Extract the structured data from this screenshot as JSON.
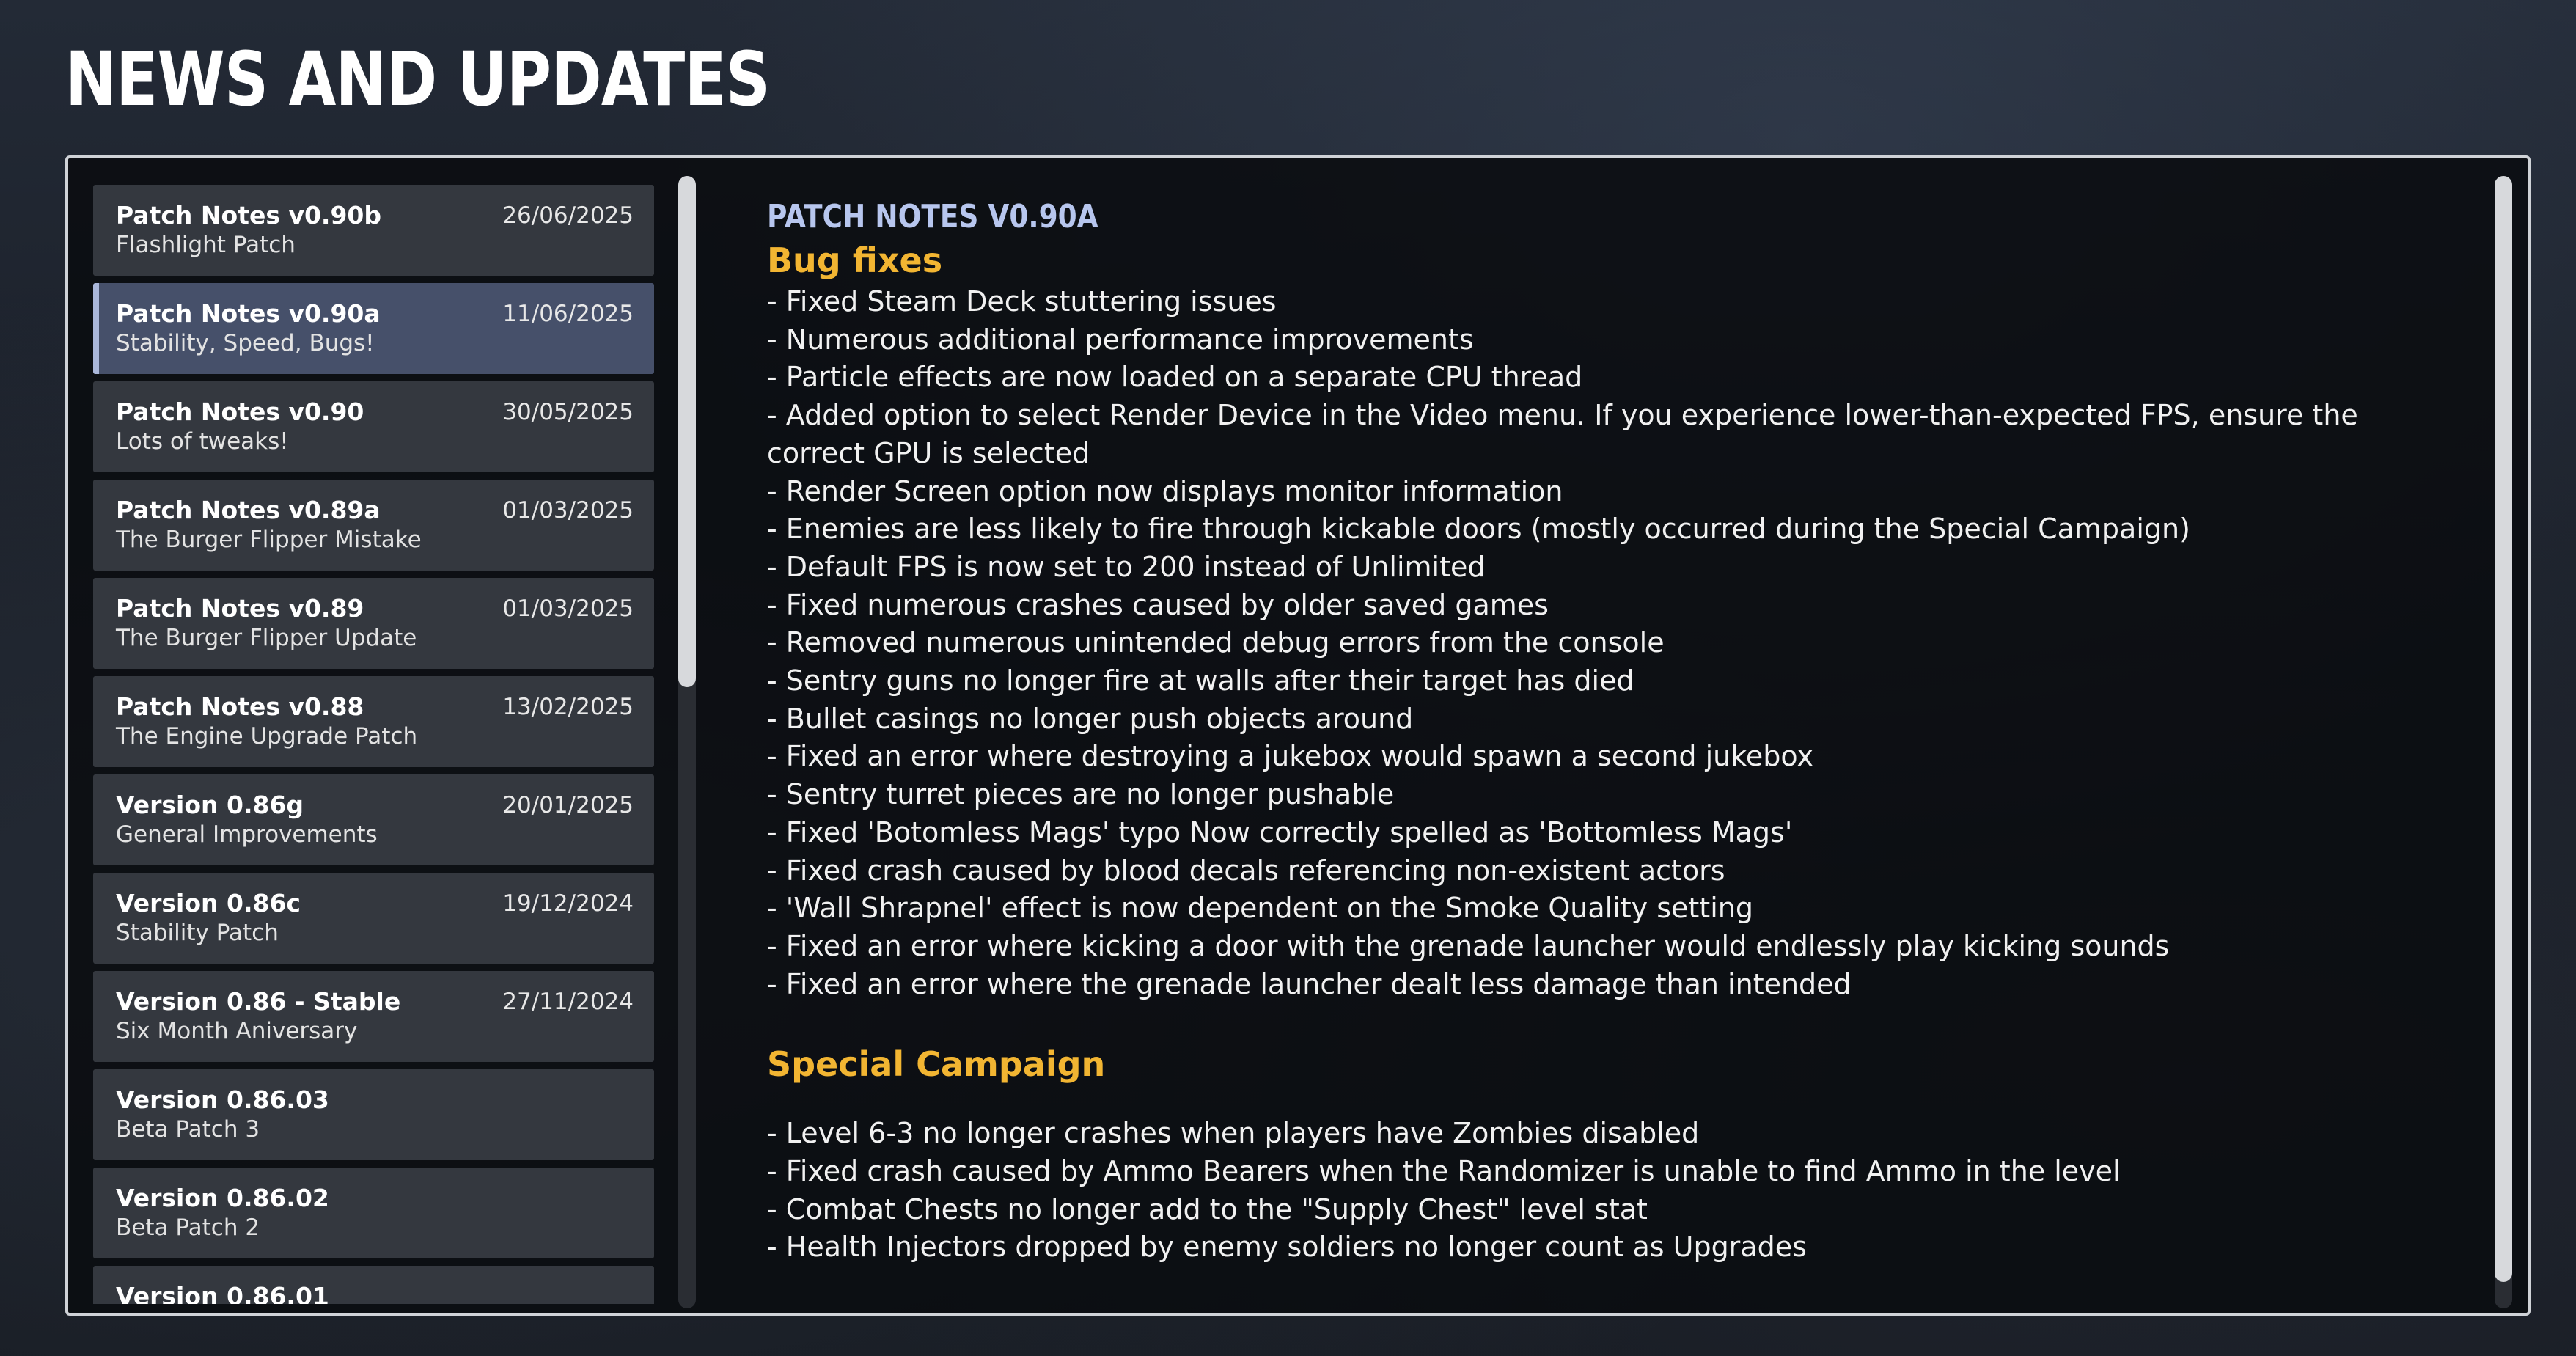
{
  "page_title": "NEWS AND UPDATES",
  "patch_list": [
    {
      "title": "Patch Notes v0.90b",
      "subtitle": "Flashlight Patch",
      "date": "26/06/2025",
      "selected": false
    },
    {
      "title": "Patch Notes v0.90a",
      "subtitle": "Stability, Speed, Bugs!",
      "date": "11/06/2025",
      "selected": true
    },
    {
      "title": "Patch Notes v0.90",
      "subtitle": "Lots of tweaks!",
      "date": "30/05/2025",
      "selected": false
    },
    {
      "title": "Patch Notes v0.89a",
      "subtitle": "The Burger Flipper Mistake",
      "date": "01/03/2025",
      "selected": false
    },
    {
      "title": "Patch Notes v0.89",
      "subtitle": "The Burger Flipper Update",
      "date": "01/03/2025",
      "selected": false
    },
    {
      "title": "Patch Notes v0.88",
      "subtitle": "The Engine Upgrade Patch",
      "date": "13/02/2025",
      "selected": false
    },
    {
      "title": "Version 0.86g",
      "subtitle": "General Improvements",
      "date": "20/01/2025",
      "selected": false
    },
    {
      "title": "Version 0.86c",
      "subtitle": "Stability Patch",
      "date": "19/12/2024",
      "selected": false
    },
    {
      "title": "Version 0.86 - Stable",
      "subtitle": "Six Month Aniversary",
      "date": "27/11/2024",
      "selected": false
    },
    {
      "title": "Version 0.86.03",
      "subtitle": "Beta Patch 3",
      "date": "",
      "selected": false
    },
    {
      "title": "Version 0.86.02",
      "subtitle": "Beta Patch 2",
      "date": "",
      "selected": false
    },
    {
      "title": "Version 0.86.01",
      "subtitle": "",
      "date": "",
      "selected": false
    }
  ],
  "content": {
    "heading": "PATCH NOTES V0.90A",
    "sections": [
      {
        "title": "Bug fixes",
        "lines": [
          "- Fixed Steam Deck stuttering issues",
          "- Numerous additional performance improvements",
          "- Particle effects are now loaded on a separate CPU thread",
          "- Added option to select Render Device in the Video menu. If you experience lower-than-expected FPS, ensure the",
          "correct GPU is selected",
          "- Render Screen option now displays monitor information",
          "- Enemies are less likely to fire through kickable doors (mostly occurred during the Special Campaign)",
          "- Default FPS is now set to 200 instead of Unlimited",
          "- Fixed numerous crashes caused by older saved games",
          "- Removed numerous unintended debug errors from the console",
          "- Sentry guns no longer fire at walls after their target has died",
          "- Bullet casings no longer push objects around",
          "- Fixed an error where destroying a jukebox would spawn a second jukebox",
          "- Sentry turret pieces are no longer pushable",
          "- Fixed 'Botomless Mags' typo   Now correctly spelled as 'Bottomless Mags'",
          "- Fixed crash caused by blood decals referencing non-existent actors",
          "- 'Wall Shrapnel' effect is now dependent on the Smoke Quality setting",
          "- Fixed an error where kicking a door with the grenade launcher would endlessly play kicking sounds",
          "- Fixed an error where the grenade launcher dealt less damage than intended"
        ]
      },
      {
        "title": "Special Campaign",
        "lines": [
          "- Level 6-3 no longer crashes when players have Zombies disabled",
          "- Fixed crash caused by Ammo Bearers when the Randomizer is unable to find Ammo in the level",
          "- Combat Chests no longer add to the \"Supply Chest\" level stat",
          "- Health Injectors dropped by enemy soldiers no longer count as Upgrades"
        ]
      }
    ]
  },
  "colors": {
    "heading_blue": "#b7c6ee",
    "section_gold": "#f2b532",
    "selected_item": "#46506a",
    "item_bg": "#34383f"
  }
}
